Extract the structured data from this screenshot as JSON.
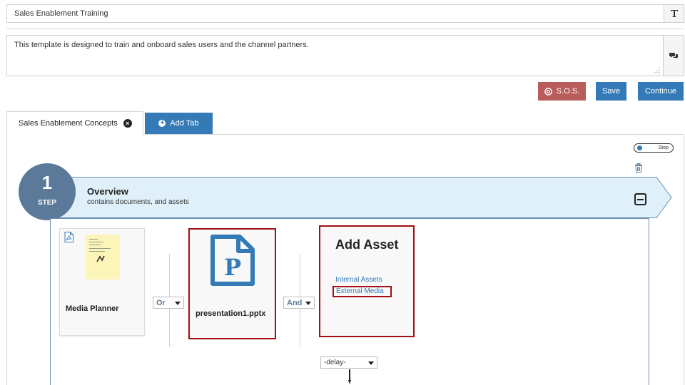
{
  "header": {
    "title_value": "Sales Enablement Training",
    "description_value": "This template is designed to train and onboard sales users and the channel partners."
  },
  "actions": {
    "sos_label": "S.O.S.",
    "save_label": "Save",
    "continue_label": "Continue"
  },
  "tabs": [
    {
      "label": "Sales Enablement Concepts",
      "active": true
    },
    {
      "label": "Add Tab",
      "active": false
    }
  ],
  "toggle": {
    "label": "Step"
  },
  "step": {
    "number": "1",
    "word": "STEP",
    "title": "Overview",
    "subtitle": "contains documents, and assets"
  },
  "assets": {
    "media": {
      "name": "Media Planner",
      "icon": "pdf-icon"
    },
    "connector1": "Or",
    "pptx": {
      "name": "presentation1.pptx",
      "icon": "powerpoint-file-icon"
    },
    "connector2": "And",
    "add_asset": {
      "heading": "Add Asset",
      "internal": "Internal Assets",
      "external": "External Media"
    }
  },
  "delay": {
    "value": "-delay-"
  },
  "colors": {
    "primary": "#337ab7",
    "sos": "#b85c5c",
    "highlight_border": "#a00f15",
    "step_circle": "#5b7a99",
    "step_banner": "#dff0fa"
  }
}
